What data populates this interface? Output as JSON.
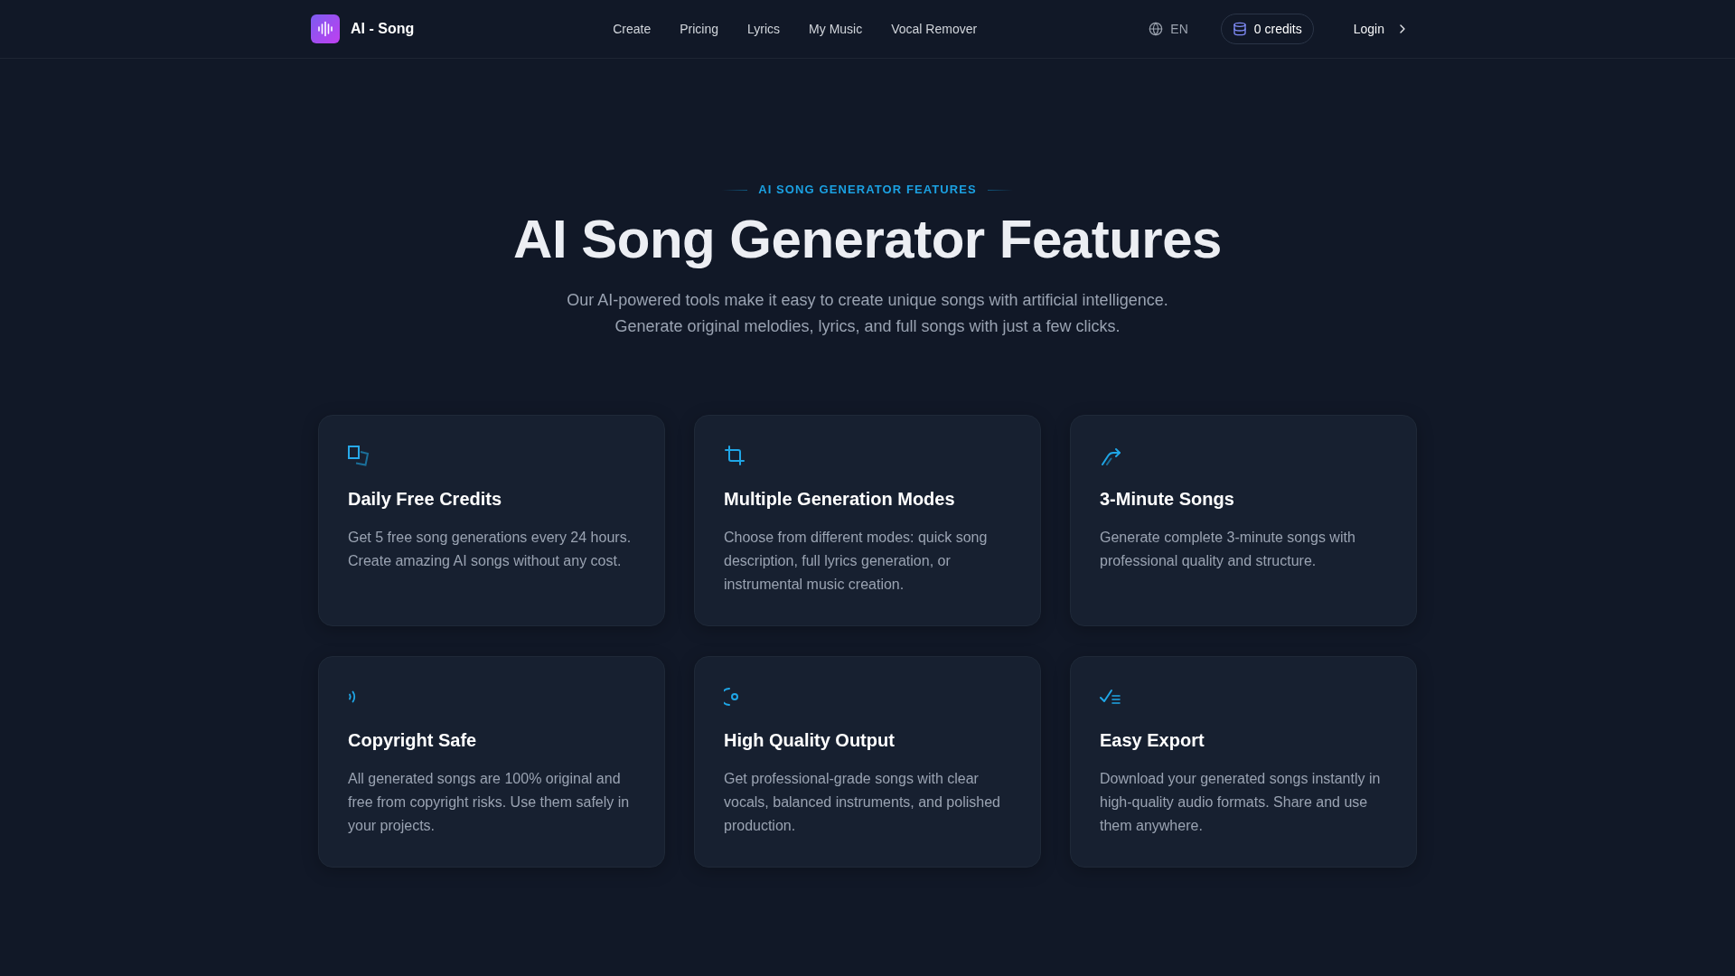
{
  "header": {
    "logo": {
      "text": "AI - Song"
    },
    "nav": [
      "Create",
      "Pricing",
      "Lyrics",
      "My Music",
      "Vocal Remover"
    ],
    "language": "EN",
    "credits": "0 credits",
    "login": "Login"
  },
  "features": {
    "eyebrow": "AI SONG GENERATOR FEATURES",
    "title": "AI Song Generator Features",
    "subtitle": [
      "Our AI-powered tools make it easy to create unique songs with artificial intelligence.",
      "Generate original melodies, lyrics, and full songs with just a few clicks."
    ],
    "cards": [
      {
        "title": "Daily Free Credits",
        "description": "Get 5 free song generations every 24 hours. Create amazing AI songs without any cost."
      },
      {
        "title": "Multiple Generation Modes",
        "description": "Choose from different modes: quick song description, full lyrics generation, or instrumental music creation."
      },
      {
        "title": "3-Minute Songs",
        "description": "Generate complete 3-minute songs with professional quality and structure."
      },
      {
        "title": "Copyright Safe",
        "description": "All generated songs are 100% original and free from copyright risks. Use them safely in your projects."
      },
      {
        "title": "High Quality Output",
        "description": "Get professional-grade songs with clear vocals, balanced instruments, and polished production."
      },
      {
        "title": "Easy Export",
        "description": "Download your generated songs instantly in high-quality audio formats. Share and use them anywhere."
      }
    ]
  }
}
